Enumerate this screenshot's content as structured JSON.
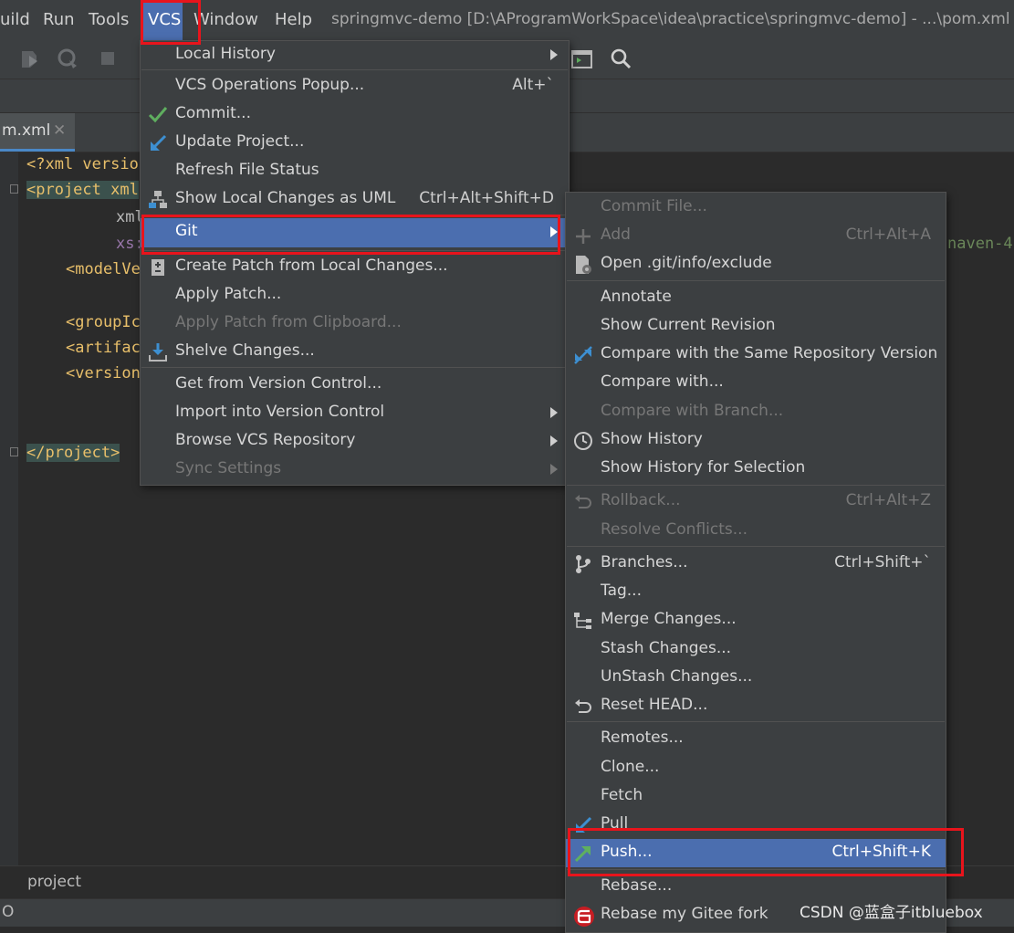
{
  "menubar": {
    "items": [
      "uild",
      "Run",
      "Tools",
      "VCS",
      "Window",
      "Help"
    ],
    "title": "springmvc-demo [D:\\AProgramWorkSpace\\idea\\practice\\springmvc-demo] - ...\\pom.xml"
  },
  "editor": {
    "tab_label": "m.xml",
    "lines": [
      "<?xml versio",
      "<project xml",
      "xml",
      "xs:",
      "<modelVe",
      "<groupIc",
      "<artifac",
      "<version",
      "</project>"
    ],
    "right_fragment": "naven-4."
  },
  "breadcrumb": "project",
  "status_text": "O",
  "vcs_menu": {
    "items": [
      {
        "label": "Local History",
        "shortcut": "",
        "submenu": true
      },
      {
        "label": "VCS Operations Popup...",
        "shortcut": "Alt+`"
      },
      {
        "label": "Commit...",
        "shortcut": ""
      },
      {
        "label": "Update Project...",
        "shortcut": ""
      },
      {
        "label": "Refresh File Status",
        "shortcut": ""
      },
      {
        "label": "Show Local Changes as UML",
        "shortcut": "Ctrl+Alt+Shift+D"
      },
      {
        "label": "Git",
        "shortcut": "",
        "submenu": true,
        "selected": true
      },
      {
        "label": "Create Patch from Local Changes...",
        "shortcut": ""
      },
      {
        "label": "Apply Patch...",
        "shortcut": ""
      },
      {
        "label": "Apply Patch from Clipboard...",
        "shortcut": "",
        "disabled": true
      },
      {
        "label": "Shelve Changes...",
        "shortcut": ""
      },
      {
        "label": "Get from Version Control...",
        "shortcut": ""
      },
      {
        "label": "Import into Version Control",
        "shortcut": "",
        "submenu": true
      },
      {
        "label": "Browse VCS Repository",
        "shortcut": "",
        "submenu": true
      },
      {
        "label": "Sync Settings",
        "shortcut": "",
        "submenu": true,
        "disabled": true
      }
    ]
  },
  "git_menu": {
    "items": [
      {
        "label": "Commit File...",
        "shortcut": "",
        "disabled": true
      },
      {
        "label": "Add",
        "shortcut": "Ctrl+Alt+A",
        "disabled": true
      },
      {
        "label": "Open .git/info/exclude",
        "shortcut": ""
      },
      {
        "label": "Annotate",
        "shortcut": ""
      },
      {
        "label": "Show Current Revision",
        "shortcut": ""
      },
      {
        "label": "Compare with the Same Repository Version",
        "shortcut": ""
      },
      {
        "label": "Compare with...",
        "shortcut": ""
      },
      {
        "label": "Compare with Branch...",
        "shortcut": "",
        "disabled": true
      },
      {
        "label": "Show History",
        "shortcut": ""
      },
      {
        "label": "Show History for Selection",
        "shortcut": ""
      },
      {
        "label": "Rollback...",
        "shortcut": "Ctrl+Alt+Z",
        "disabled": true
      },
      {
        "label": "Resolve Conflicts...",
        "shortcut": "",
        "disabled": true
      },
      {
        "label": "Branches...",
        "shortcut": "Ctrl+Shift+`"
      },
      {
        "label": "Tag...",
        "shortcut": ""
      },
      {
        "label": "Merge Changes...",
        "shortcut": ""
      },
      {
        "label": "Stash Changes...",
        "shortcut": ""
      },
      {
        "label": "UnStash Changes...",
        "shortcut": ""
      },
      {
        "label": "Reset HEAD...",
        "shortcut": ""
      },
      {
        "label": "Remotes...",
        "shortcut": ""
      },
      {
        "label": "Clone...",
        "shortcut": ""
      },
      {
        "label": "Fetch",
        "shortcut": ""
      },
      {
        "label": "Pull",
        "shortcut": ""
      },
      {
        "label": "Push...",
        "shortcut": "Ctrl+Shift+K",
        "selected": true
      },
      {
        "label": "Rebase...",
        "shortcut": ""
      },
      {
        "label": "Rebase my Gitee fork",
        "shortcut": ""
      }
    ]
  },
  "watermark": "CSDN @蓝盒子itbluebox",
  "colors": {
    "selection": "#4b6eaf",
    "highlight_box": "#e8141c",
    "menu_bg": "#3c3f41"
  }
}
